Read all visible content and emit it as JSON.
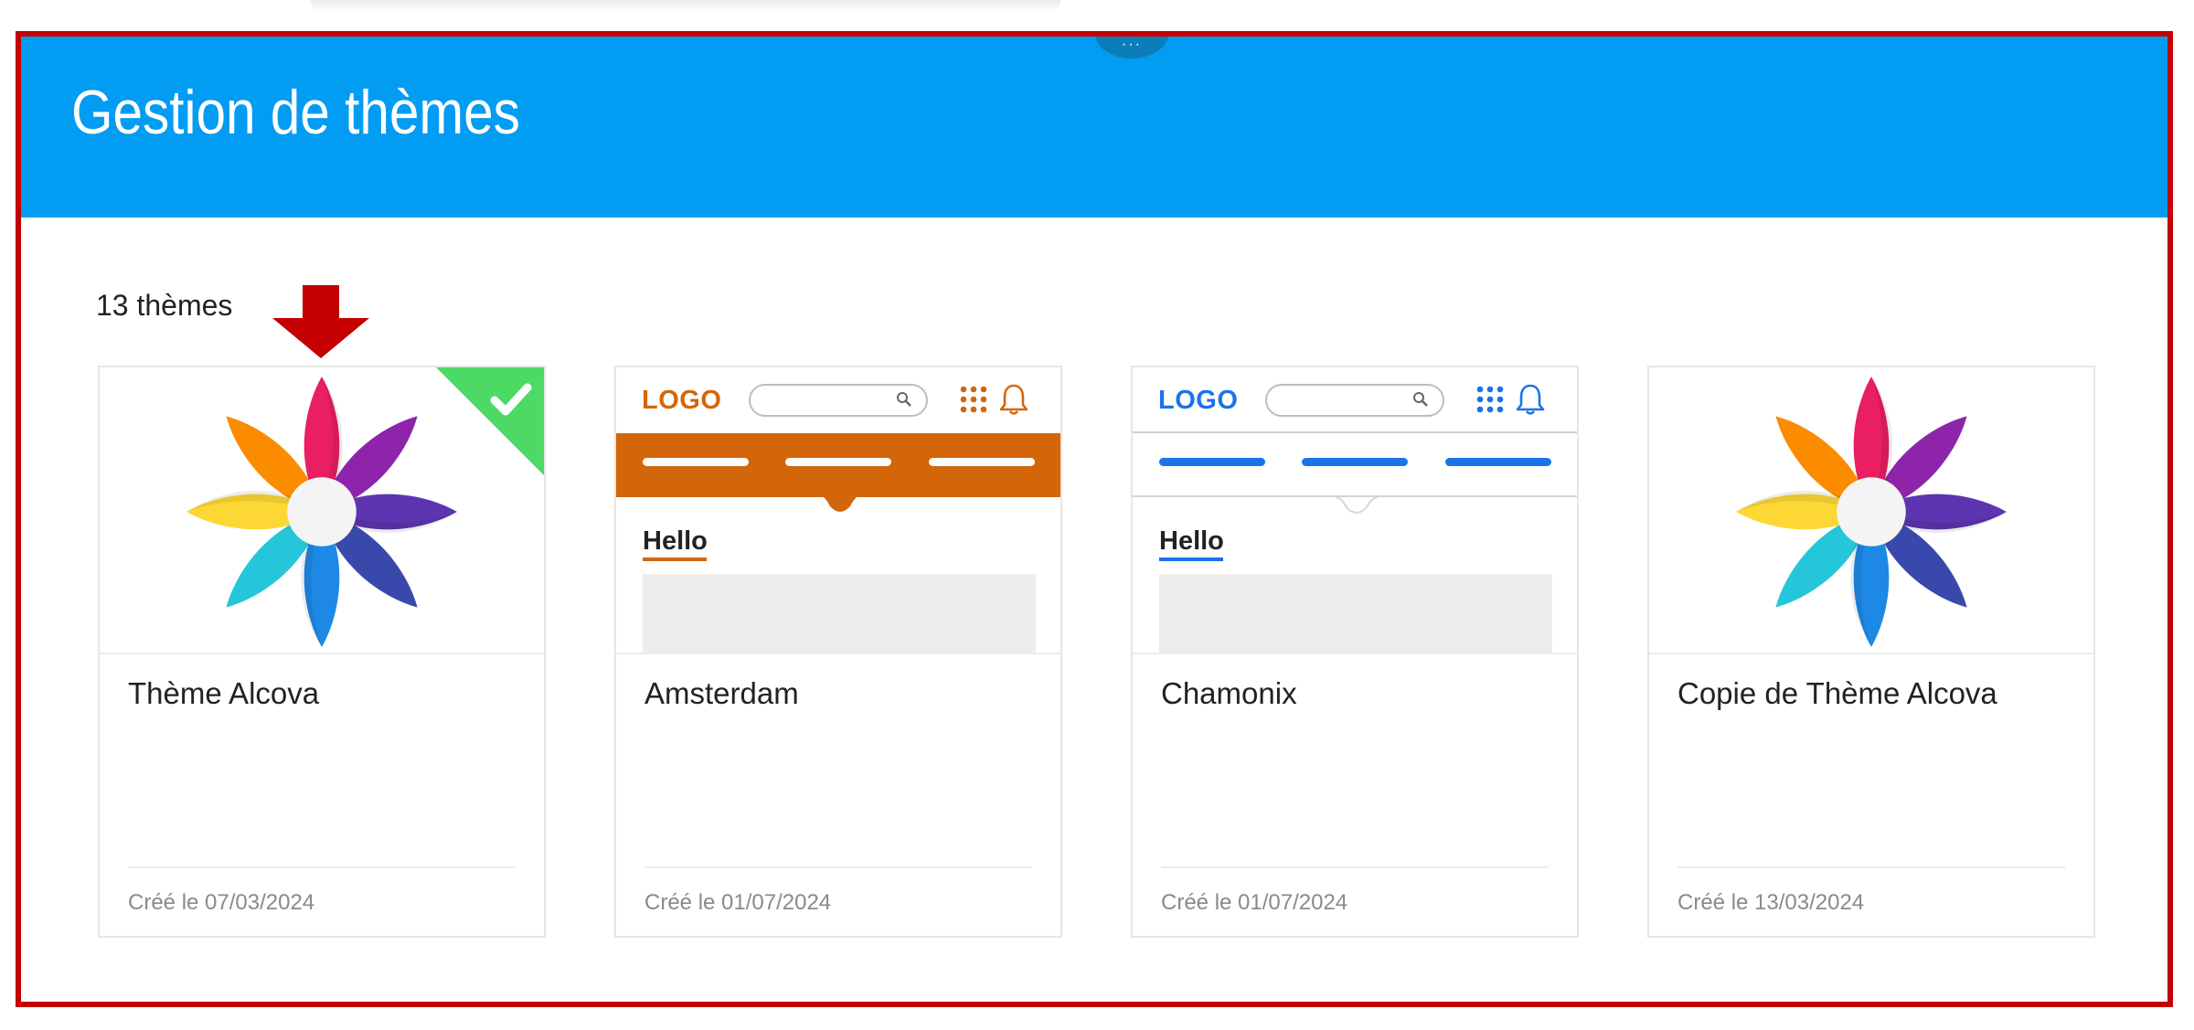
{
  "header": {
    "title": "Gestion de thèmes",
    "handle_label": "···"
  },
  "theme_count_label": "13 thèmes",
  "colors": {
    "header_bg": "#039cf3",
    "frame_border": "#c40000",
    "active_check": "#4cd964",
    "amsterdam_accent": "#d4660a",
    "chamonix_accent": "#1a73e8"
  },
  "cards": [
    {
      "title": "Thème Alcova",
      "date": "Créé le 07/03/2024",
      "preview": "flower-icon",
      "active": true
    },
    {
      "title": "Amsterdam",
      "date": "Créé le 01/07/2024",
      "preview": "mini-ui",
      "logo": "LOGO",
      "hello": "Hello"
    },
    {
      "title": "Chamonix",
      "date": "Créé le 01/07/2024",
      "preview": "mini-ui",
      "logo": "LOGO",
      "hello": "Hello"
    },
    {
      "title": "Copie de Thème Alcova",
      "date": "Créé le 13/03/2024",
      "preview": "flower-icon",
      "active": false
    }
  ]
}
